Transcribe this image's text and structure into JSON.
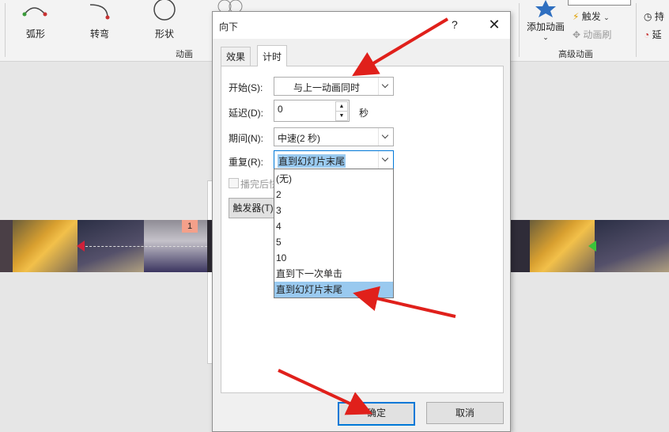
{
  "ribbon": {
    "paths": [
      {
        "label": "弧形",
        "icon": "arc-path-icon"
      },
      {
        "label": "转弯",
        "icon": "turn-path-icon"
      },
      {
        "label": "形状",
        "icon": "shape-path-icon"
      }
    ],
    "group_animation": "动画",
    "group_advanced": "高级动画",
    "add_animation": "添加动画",
    "trigger": "触发",
    "animation_painter": "动画刷",
    "right_labels": [
      "持",
      "延"
    ]
  },
  "dialog": {
    "title": "向下",
    "help": "?",
    "tabs": [
      "效果",
      "计时"
    ],
    "active_tab": "计时",
    "fields": {
      "start_label": "开始(S):",
      "start_value": "与上一动画同时",
      "delay_label": "延迟(D):",
      "delay_value": "0",
      "delay_unit": "秒",
      "duration_label": "期间(N):",
      "duration_value": "中速(2 秒)",
      "repeat_label": "重复(R):",
      "repeat_value": "直到幻灯片末尾",
      "rewind_label": "播完后快",
      "trigger_button": "触发器(T)"
    },
    "repeat_options": [
      "(无)",
      "2",
      "3",
      "4",
      "5",
      "10",
      "直到下一次单击",
      "直到幻灯片末尾"
    ],
    "repeat_selected_index": 7,
    "ok_label": "确定",
    "cancel_label": "取消"
  },
  "timeline": {
    "badge": "1"
  },
  "colors": {
    "accent": "#0078d7",
    "arrow": "#e0201b",
    "selection": "#99c9ef"
  }
}
